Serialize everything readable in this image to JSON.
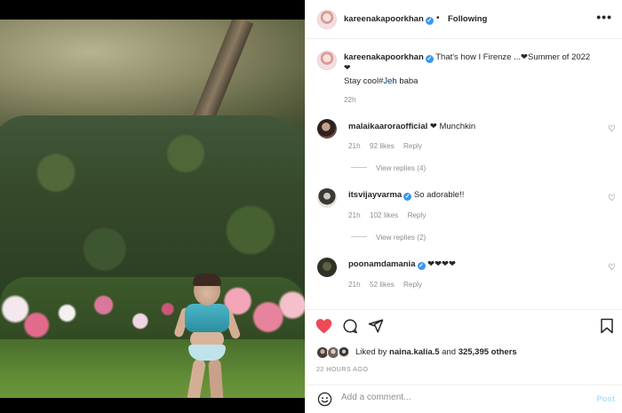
{
  "post": {
    "author": "kareenakapoorkhan",
    "follow_state": "Following",
    "dot": "•",
    "more": "•••",
    "caption_text": "That's how I Firenze ...❤Summer of 2022",
    "caption_heart": "❤",
    "caption_line2_prefix": "Stay cool",
    "caption_hashtag": "#Jeh",
    "caption_line2_suffix": " baba",
    "caption_time": "22h"
  },
  "comments": [
    {
      "user": "malaikaaroraofficial",
      "text": "❤ Munchkin",
      "time": "21h",
      "likes": "92 likes",
      "reply": "Reply",
      "view_replies": "View replies (4)"
    },
    {
      "user": "itsvijayvarma",
      "text": "So adorable!!",
      "time": "21h",
      "likes": "102 likes",
      "reply": "Reply",
      "view_replies": "View replies (2)"
    },
    {
      "user": "poonamdamania",
      "text": "❤❤❤❤",
      "time": "21h",
      "likes": "52 likes",
      "reply": "Reply"
    }
  ],
  "actions": {
    "liked_by_prefix": "Liked by ",
    "liked_by_user": "naina.kalia.5",
    "liked_by_and": " and ",
    "liked_by_count": "325,395 others",
    "posted_when": "22 HOURS AGO"
  },
  "add_comment": {
    "placeholder": "Add a comment...",
    "post_label": "Post"
  },
  "colors": {
    "like_red": "#ed4956",
    "verified_blue": "#3897f0",
    "post_disabled": "#b2dffc"
  },
  "icons": [
    "heart-icon",
    "comment-icon",
    "share-icon",
    "save-icon",
    "emoji-icon",
    "verified-badge-icon",
    "more-options-icon"
  ]
}
